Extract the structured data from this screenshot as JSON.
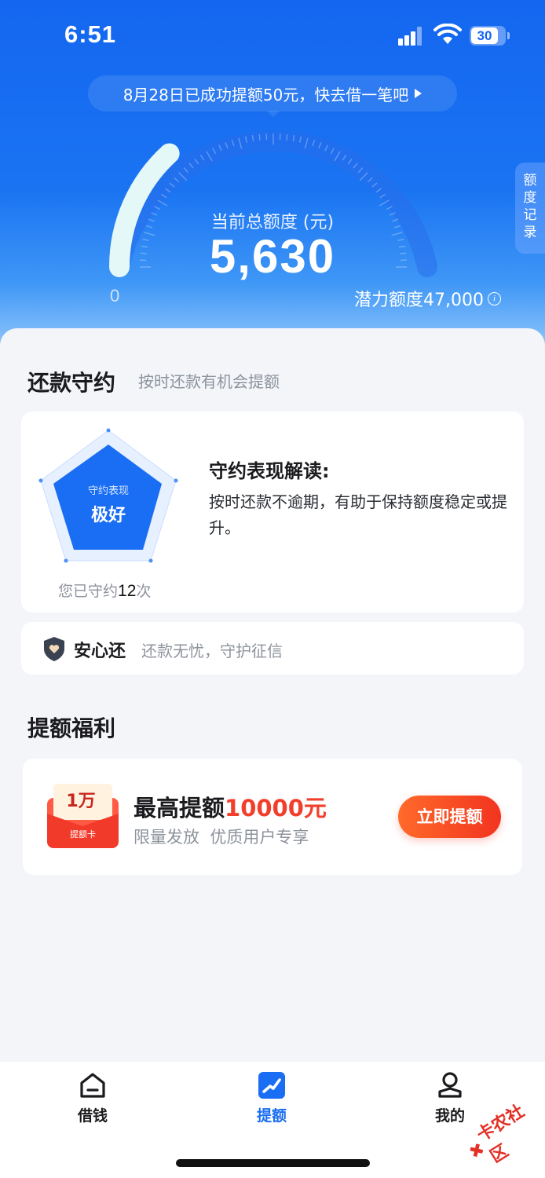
{
  "status_bar": {
    "time": "6:51",
    "battery": "30"
  },
  "promo": {
    "text": "8月28日已成功提额50元，快去借一笔吧"
  },
  "credit": {
    "title": "当前总额度 (元)",
    "value": "5,630",
    "min_label": "0",
    "potential_label": "潜力额度47,000",
    "progress_fraction": 0.12
  },
  "side_tab": {
    "label": "额度记录"
  },
  "repayment": {
    "title": "还款守约",
    "subtitle": "按时还款有机会提额",
    "performance_label": "守约表现",
    "performance_value": "极好",
    "count_prefix": "您已守约",
    "count": "12",
    "count_suffix": "次",
    "interpret_title": "守约表现解读:",
    "interpret_text": "按时还款不逾期，有助于保持额度稳定或提升。"
  },
  "safe_repay": {
    "name": "安心还",
    "desc": "还款无忧，守护征信"
  },
  "welfare": {
    "title": "提额福利",
    "card_amount": "1万",
    "card_label": "提额卡",
    "head_prefix": "最高提额",
    "head_amount": "10000元",
    "sub": "限量发放  优质用户专享",
    "button": "立即提额"
  },
  "tabbar": {
    "items": [
      {
        "label": "借钱",
        "icon": "home-icon",
        "active": false
      },
      {
        "label": "提额",
        "icon": "lift-icon",
        "active": true
      },
      {
        "label": "我的",
        "icon": "user-icon",
        "active": false
      }
    ]
  },
  "watermark": {
    "text": "卡农社区"
  },
  "colors": {
    "brand_blue": "#1466f0",
    "accent_red": "#f23f2c",
    "active_tab": "#1a6ef4"
  }
}
